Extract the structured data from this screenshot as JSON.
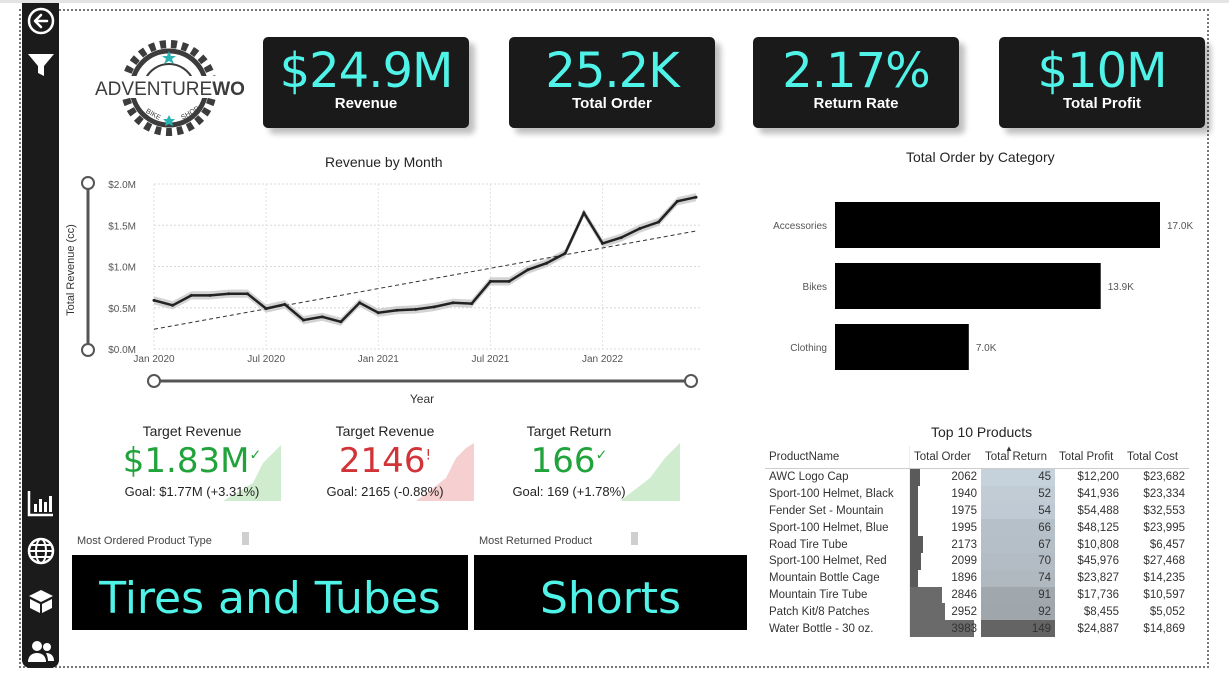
{
  "app": {
    "logo_text_1": "ADVENTURE",
    "logo_text_2": "WORKS",
    "logo_sub_1": "BIKE",
    "logo_sub_2": "SHOP"
  },
  "colors": {
    "accent": "#4ff3e8",
    "card_bg": "#1a1a1a",
    "good": "#20a33a",
    "bad": "#d13438"
  },
  "sidebar": {
    "icons": [
      "back-arrow-icon",
      "filter-icon",
      "bar-chart-icon",
      "globe-icon",
      "box-icon",
      "users-icon"
    ]
  },
  "kpis": [
    {
      "value": "$24.9M",
      "label": "Revenue"
    },
    {
      "value": "25.2K",
      "label": "Total Order"
    },
    {
      "value": "2.17%",
      "label": "Return Rate"
    },
    {
      "value": "$10M",
      "label": "Total Profit"
    }
  ],
  "revenue_chart": {
    "title": "Revenue by Month",
    "ylabel": "Total Revenue (cc)",
    "xlabel": "Year",
    "yticks": [
      "$0.0M",
      "$0.5M",
      "$1.0M",
      "$1.5M",
      "$2.0M"
    ],
    "xticks": [
      "Jan 2020",
      "Jul 2020",
      "Jan 2021",
      "Jul 2021",
      "Jan 2022"
    ]
  },
  "category_chart": {
    "title": "Total Order by Category",
    "labels": [
      "Accessories",
      "Bikes",
      "Clothing"
    ],
    "value_labels": [
      "17.0K",
      "13.9K",
      "7.0K"
    ]
  },
  "chart_data": [
    {
      "type": "line",
      "title": "Revenue by Month",
      "xlabel": "Year",
      "ylabel": "Total Revenue (cc)",
      "ylim": [
        0,
        2.0
      ],
      "x": [
        "2020-01",
        "2020-02",
        "2020-03",
        "2020-04",
        "2020-05",
        "2020-06",
        "2020-07",
        "2020-08",
        "2020-09",
        "2020-10",
        "2020-11",
        "2020-12",
        "2021-01",
        "2021-02",
        "2021-03",
        "2021-04",
        "2021-05",
        "2021-06",
        "2021-07",
        "2021-08",
        "2021-09",
        "2021-10",
        "2021-11",
        "2021-12",
        "2022-01",
        "2022-02",
        "2022-03",
        "2022-04",
        "2022-05",
        "2022-06"
      ],
      "series": [
        {
          "values": [
            0.59,
            0.53,
            0.65,
            0.65,
            0.67,
            0.67,
            0.49,
            0.54,
            0.35,
            0.39,
            0.33,
            0.56,
            0.44,
            0.47,
            0.48,
            0.51,
            0.56,
            0.55,
            0.82,
            0.82,
            0.96,
            1.04,
            1.16,
            1.65,
            1.28,
            1.35,
            1.46,
            1.54,
            1.79,
            1.84
          ]
        }
      ],
      "trendline": [
        0.24,
        1.43
      ],
      "grid": true
    },
    {
      "type": "bar",
      "title": "Total Order by Category",
      "categories": [
        "Accessories",
        "Bikes",
        "Clothing"
      ],
      "values": [
        17.0,
        13.9,
        7.0
      ],
      "value_unit": "K"
    }
  ],
  "targets": [
    {
      "title": "Target Revenue",
      "value": "$1.83M",
      "mark": "✓",
      "goal": "Goal: $1.77M (+3.31%)",
      "status": "good"
    },
    {
      "title": "Target Revenue",
      "value": "2146",
      "mark": "!",
      "goal": "Goal: 2165 (-0.88%)",
      "status": "bad"
    },
    {
      "title": "Target Return",
      "value": "166",
      "mark": "✓",
      "goal": "Goal: 169 (+1.78%)",
      "status": "good"
    }
  ],
  "most_ordered": {
    "label": "Most Ordered Product Type",
    "value": "Tires and Tubes"
  },
  "most_returned": {
    "label": "Most Returned Product",
    "value": "Shorts"
  },
  "top10": {
    "title": "Top 10 Products",
    "columns": [
      "ProductName",
      "Total Order",
      "Total Return",
      "Total Profit",
      "Total Cost"
    ],
    "rows": [
      [
        "AWC Logo Cap",
        "2062",
        "45",
        "$12,200",
        "$23,682"
      ],
      [
        "Sport-100 Helmet, Black",
        "1940",
        "52",
        "$41,936",
        "$23,334"
      ],
      [
        "Fender Set - Mountain",
        "1975",
        "54",
        "$54,488",
        "$32,553"
      ],
      [
        "Sport-100 Helmet, Blue",
        "1995",
        "66",
        "$48,125",
        "$23,995"
      ],
      [
        "Road Tire Tube",
        "2173",
        "67",
        "$10,808",
        "$6,457"
      ],
      [
        "Sport-100 Helmet, Red",
        "2099",
        "70",
        "$45,976",
        "$27,468"
      ],
      [
        "Mountain Bottle Cage",
        "1896",
        "74",
        "$23,827",
        "$14,235"
      ],
      [
        "Mountain Tire Tube",
        "2846",
        "91",
        "$17,736",
        "$10,597"
      ],
      [
        "Patch Kit/8 Patches",
        "2952",
        "92",
        "$8,455",
        "$5,052"
      ],
      [
        "Water Bottle - 30 oz.",
        "3983",
        "149",
        "$24,887",
        "$14,869"
      ]
    ]
  }
}
